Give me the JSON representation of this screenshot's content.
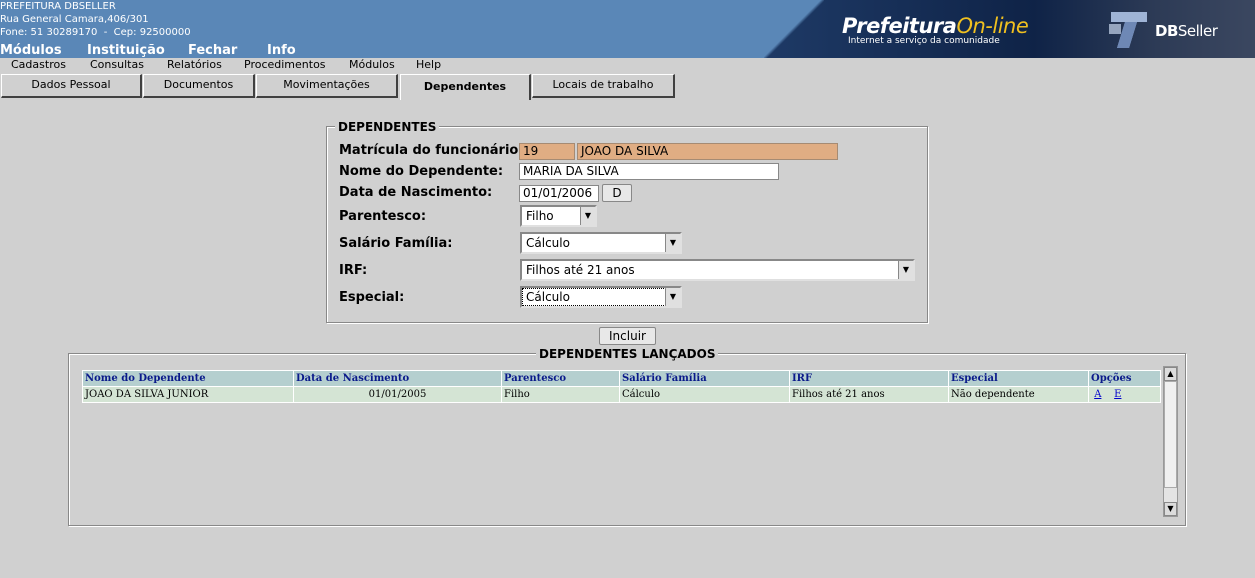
{
  "header": {
    "company_name": "PREFEITURA DBSELLER",
    "address": "Rua General Camara,406/301",
    "phone_line": "Fone: 51 30289170  -  Cep: 92500000",
    "menu": [
      "Módulos",
      "Instituição",
      "Fechar",
      "Info"
    ],
    "banner": {
      "portal_title": "Prefeitura",
      "portal_title_highlight": "On-line",
      "portal_subtitle": "Internet a serviço da comunidade",
      "vendor_prefix": "DB",
      "vendor_suffix": "Seller"
    }
  },
  "submenu": [
    "Cadastros",
    "Consultas",
    "Relatórios",
    "Procedimentos",
    "Módulos",
    "Help"
  ],
  "tabs": [
    "Dados Pessoal",
    "Documentos",
    "Movimentações",
    "Dependentes",
    "Locais de trabalho"
  ],
  "active_tab": "Dependentes",
  "form": {
    "legend": "DEPENDENTES",
    "matricula_label": "Matrícula do funcionário:",
    "matricula_value": "19",
    "funcionario_nome": "JOAO DA SILVA",
    "nome_label": "Nome do Dependente:",
    "nome_value": "MARIA DA SILVA",
    "nascimento_label": "Data de Nascimento:",
    "nascimento_value": "01/01/2006",
    "date_button": "D",
    "parentesco_label": "Parentesco:",
    "parentesco_value": "Filho",
    "salario_label": "Salário Família:",
    "salario_value": "Cálculo",
    "irf_label": "IRF:",
    "irf_value": "Filhos até 21 anos",
    "especial_label": "Especial:",
    "especial_value": "Cálculo",
    "incluir_button": "Incluir"
  },
  "lancados": {
    "legend": "DEPENDENTES LANÇADOS",
    "columns": [
      "Nome do Dependente",
      "Data de Nascimento",
      "Parentesco",
      "Salário Família",
      "IRF",
      "Especial",
      "Opções"
    ],
    "rows": [
      {
        "nome": "JOAO DA SILVA JUNIOR",
        "nascimento": "01/01/2005",
        "parentesco": "Filho",
        "salario": "Cálculo",
        "irf": "Filhos até 21 anos",
        "especial": "Não dependente",
        "opcao_alterar": "A",
        "opcao_excluir": "E"
      }
    ]
  },
  "colors": {
    "header_bg": "#5a87b7",
    "page_bg": "#d0d0d0",
    "readonly_field": "#e0ad83",
    "table_header": "#b5cfcf",
    "table_row": "#d4e4d4",
    "table_header_text": "#0a1a8a"
  }
}
